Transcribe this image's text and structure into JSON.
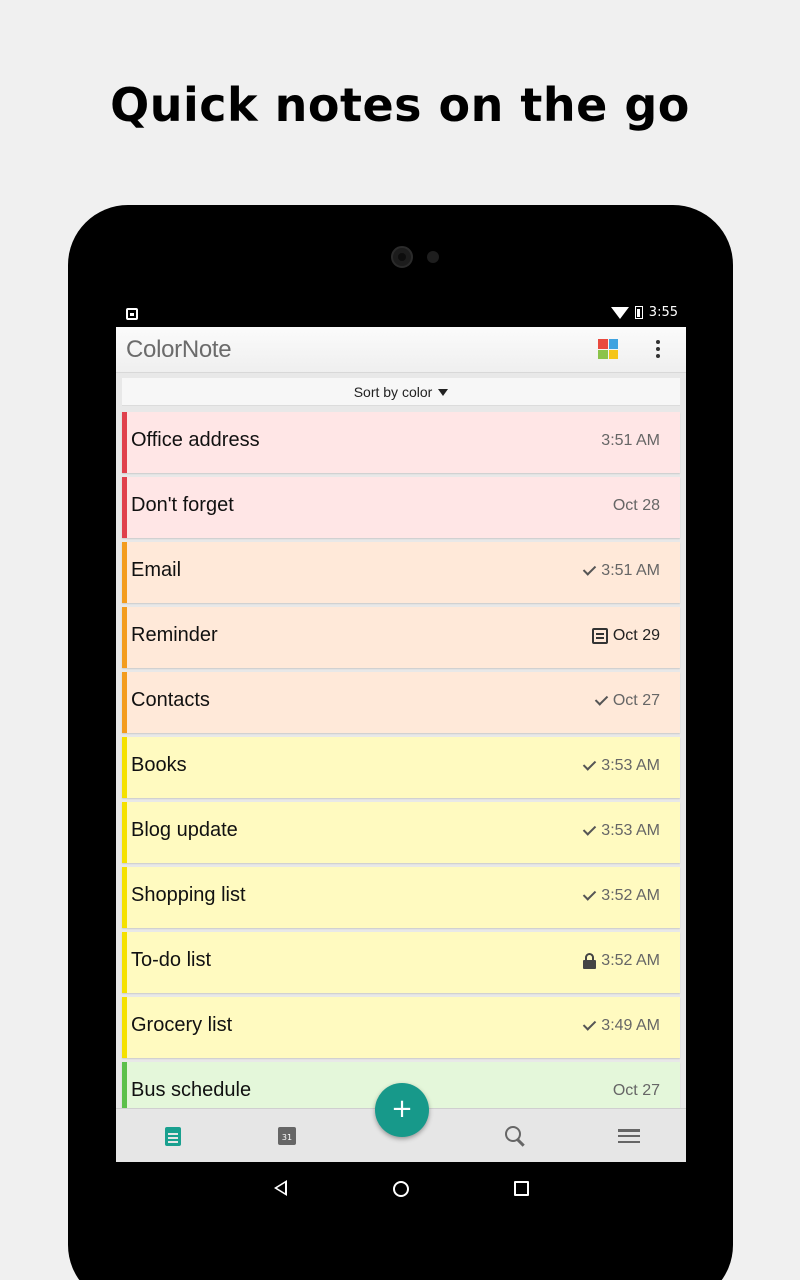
{
  "headline": "Quick notes on the go",
  "status": {
    "time": "3:55"
  },
  "app": {
    "logo": "ColorNote",
    "palette_colors": [
      "#e94a3f",
      "#3fa3e0",
      "#8bc34a",
      "#f5c518"
    ],
    "sort_label": "Sort by color"
  },
  "notes": [
    {
      "title": "Office address",
      "meta": "3:51 AM",
      "icon": "",
      "bg": "#ffe6e6",
      "stripe": "#e0404c"
    },
    {
      "title": "Don't forget",
      "meta": "Oct 28",
      "icon": "",
      "bg": "#ffe6e6",
      "stripe": "#e0404c"
    },
    {
      "title": "Email",
      "meta": "3:51 AM",
      "icon": "check-icon",
      "bg": "#ffe9d9",
      "stripe": "#f39c1e"
    },
    {
      "title": "Reminder",
      "meta": "Oct 29",
      "icon": "reminder-icon",
      "bg": "#ffe9d9",
      "stripe": "#f39c1e"
    },
    {
      "title": "Contacts",
      "meta": "Oct 27",
      "icon": "check-icon",
      "bg": "#ffe9d9",
      "stripe": "#f39c1e"
    },
    {
      "title": "Books",
      "meta": "3:53 AM",
      "icon": "check-icon",
      "bg": "#fffac0",
      "stripe": "#f5e100"
    },
    {
      "title": "Blog update",
      "meta": "3:53 AM",
      "icon": "check-icon",
      "bg": "#fffac0",
      "stripe": "#f5e100"
    },
    {
      "title": "Shopping list",
      "meta": "3:52 AM",
      "icon": "check-icon",
      "bg": "#fffac0",
      "stripe": "#f5e100"
    },
    {
      "title": "To-do list",
      "meta": "3:52 AM",
      "icon": "lock-icon",
      "bg": "#fffac0",
      "stripe": "#f5e100"
    },
    {
      "title": "Grocery list",
      "meta": "3:49 AM",
      "icon": "check-icon",
      "bg": "#fffac0",
      "stripe": "#f5e100"
    },
    {
      "title": "Bus schedule",
      "meta": "Oct 27",
      "icon": "",
      "bg": "#e4f7da",
      "stripe": "#5cc04a"
    }
  ],
  "bottom_nav": {
    "calendar_day": "31",
    "fab_label": "+",
    "active_color": "#19a08f"
  }
}
